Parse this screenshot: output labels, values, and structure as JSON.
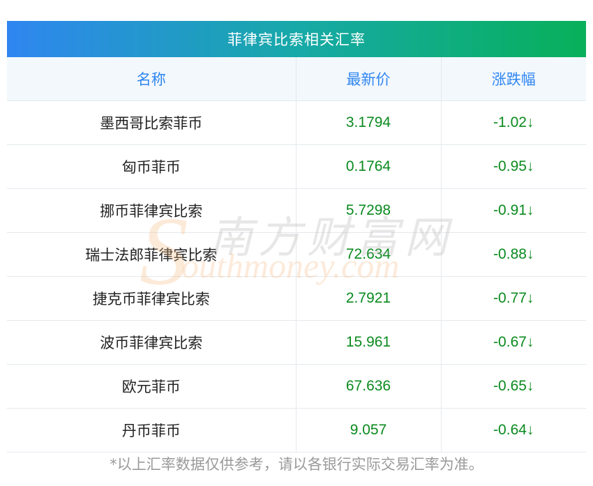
{
  "title": "菲律宾比索相关汇率",
  "columns": [
    "名称",
    "最新价",
    "涨跌幅"
  ],
  "rows": [
    {
      "name": "墨西哥比索菲币",
      "price": "3.1794",
      "change": "-1.02↓"
    },
    {
      "name": "匈币菲币",
      "price": "0.1764",
      "change": "-0.95↓"
    },
    {
      "name": "挪币菲律宾比索",
      "price": "5.7298",
      "change": "-0.91↓"
    },
    {
      "name": "瑞士法郎菲律宾比索",
      "price": "72.634",
      "change": "-0.88↓"
    },
    {
      "name": "捷克币菲律宾比索",
      "price": "2.7921",
      "change": "-0.77↓"
    },
    {
      "name": "波币菲律宾比索",
      "price": "15.961",
      "change": "-0.67↓"
    },
    {
      "name": "欧元菲币",
      "price": "67.636",
      "change": "-0.65↓"
    },
    {
      "name": "丹币菲币",
      "price": "9.057",
      "change": "-0.64↓"
    }
  ],
  "watermark": {
    "cn": "南方财富网",
    "en": "outhmoney.com",
    "s": "S"
  },
  "footnote": "*以上汇率数据仅供参考，请以各银行实际交易汇率为准。",
  "colors": {
    "accent": "#2f86f0",
    "negative": "#0a8a1e",
    "header_bg": "#f3f8fd"
  }
}
